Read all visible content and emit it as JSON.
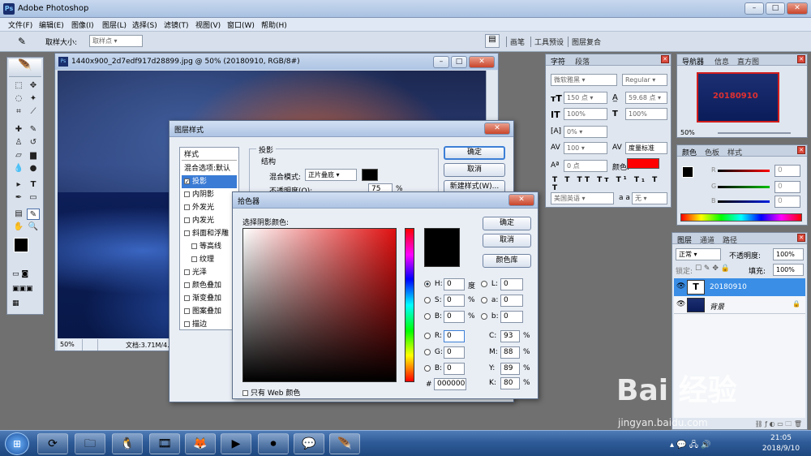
{
  "app": {
    "title": "Adobe Photoshop"
  },
  "menu": [
    "文件(F)",
    "编辑(E)",
    "图像(I)",
    "图层(L)",
    "选择(S)",
    "滤镜(T)",
    "视图(V)",
    "窗口(W)",
    "帮助(H)"
  ],
  "options": {
    "sample_size_label": "取样大小:",
    "sample_size_value": "取样点",
    "palette_tabs": [
      "画笔",
      "工具预设",
      "图层复合"
    ]
  },
  "document": {
    "title": "1440x900_2d7edf917d28899.jpg @ 50% (20180910, RGB/8#)",
    "zoom": "50%",
    "status": "文档:3.71M/4.4",
    "canvas_text": "2"
  },
  "layer_style": {
    "title": "图层样式",
    "styles_header": "样式",
    "items": [
      {
        "label": "混合选项:默认",
        "checkbox": false,
        "selected": false
      },
      {
        "label": "投影",
        "checkbox": true,
        "checked": true,
        "selected": true
      },
      {
        "label": "内阴影",
        "checkbox": true
      },
      {
        "label": "外发光",
        "checkbox": true
      },
      {
        "label": "内发光",
        "checkbox": true
      },
      {
        "label": "斜面和浮雕",
        "checkbox": true
      },
      {
        "label": "等高线",
        "checkbox": true,
        "indent": true
      },
      {
        "label": "纹理",
        "checkbox": true,
        "indent": true
      },
      {
        "label": "光泽",
        "checkbox": true
      },
      {
        "label": "颜色叠加",
        "checkbox": true
      },
      {
        "label": "渐变叠加",
        "checkbox": true
      },
      {
        "label": "图案叠加",
        "checkbox": true
      },
      {
        "label": "描边",
        "checkbox": true
      }
    ],
    "section_title": "投影",
    "structure_title": "结构",
    "blend_mode_label": "混合模式:",
    "blend_mode_value": "正片叠底",
    "opacity_label": "不透明度(O):",
    "opacity_value": "75",
    "opacity_unit": "%",
    "ok": "确定",
    "cancel": "取消",
    "new_style": "新建样式(W)..."
  },
  "color_picker": {
    "title": "拾色器",
    "prompt": "选择阴影颜色:",
    "ok": "确定",
    "cancel": "取消",
    "library": "颜色库",
    "hsb": [
      {
        "label": "H:",
        "value": "0",
        "unit": "度",
        "selected": true
      },
      {
        "label": "S:",
        "value": "0",
        "unit": "%"
      },
      {
        "label": "B:",
        "value": "0",
        "unit": "%"
      }
    ],
    "rgb": [
      {
        "label": "R:",
        "value": "0"
      },
      {
        "label": "G:",
        "value": "0"
      },
      {
        "label": "B:",
        "value": "0"
      }
    ],
    "lab": [
      {
        "label": "L:",
        "value": "0"
      },
      {
        "label": "a:",
        "value": "0"
      },
      {
        "label": "b:",
        "value": "0"
      }
    ],
    "cmyk": [
      {
        "label": "C:",
        "value": "93",
        "unit": "%"
      },
      {
        "label": "M:",
        "value": "88",
        "unit": "%"
      },
      {
        "label": "Y:",
        "value": "89",
        "unit": "%"
      },
      {
        "label": "K:",
        "value": "80",
        "unit": "%"
      }
    ],
    "hex_label": "#",
    "hex_value": "000000",
    "web_only": "只有 Web 颜色",
    "current_color": "#000000"
  },
  "char_panel": {
    "tabs": [
      "字符",
      "段落"
    ],
    "font": "微软雅黑",
    "style": "Regular",
    "size": "150 点",
    "leading": "59.68 点",
    "v_scale": "100%",
    "h_scale": "100%",
    "tracking": "0%",
    "kerning_a": "100",
    "kerning_b": "度量标准",
    "baseline": "0 点",
    "color_label": "颜色:",
    "language": "美国英语",
    "aa_label": "a a",
    "aa_value": "无",
    "text_color": "#ff0000"
  },
  "navigator": {
    "tabs": [
      "导航器",
      "信息",
      "直方图"
    ],
    "zoom": "50%",
    "thumb_text": "20180910"
  },
  "color_panel": {
    "tabs": [
      "颜色",
      "色板",
      "样式"
    ],
    "r": "0",
    "g": "0",
    "b": "0"
  },
  "layers_panel": {
    "tabs": [
      "图层",
      "通道",
      "路径"
    ],
    "blend": "正常",
    "opacity_label": "不透明度:",
    "opacity": "100%",
    "lock_label": "锁定:",
    "fill_label": "填充:",
    "fill": "100%",
    "layers": [
      {
        "name": "20180910",
        "type": "text",
        "selected": true
      },
      {
        "name": "背景",
        "type": "image",
        "selected": false
      }
    ]
  },
  "taskbar": {
    "time": "21:05",
    "date": "2018/9/10"
  },
  "watermark": {
    "brand": "Bai 经验",
    "url": "jingyan.baidu.com"
  }
}
